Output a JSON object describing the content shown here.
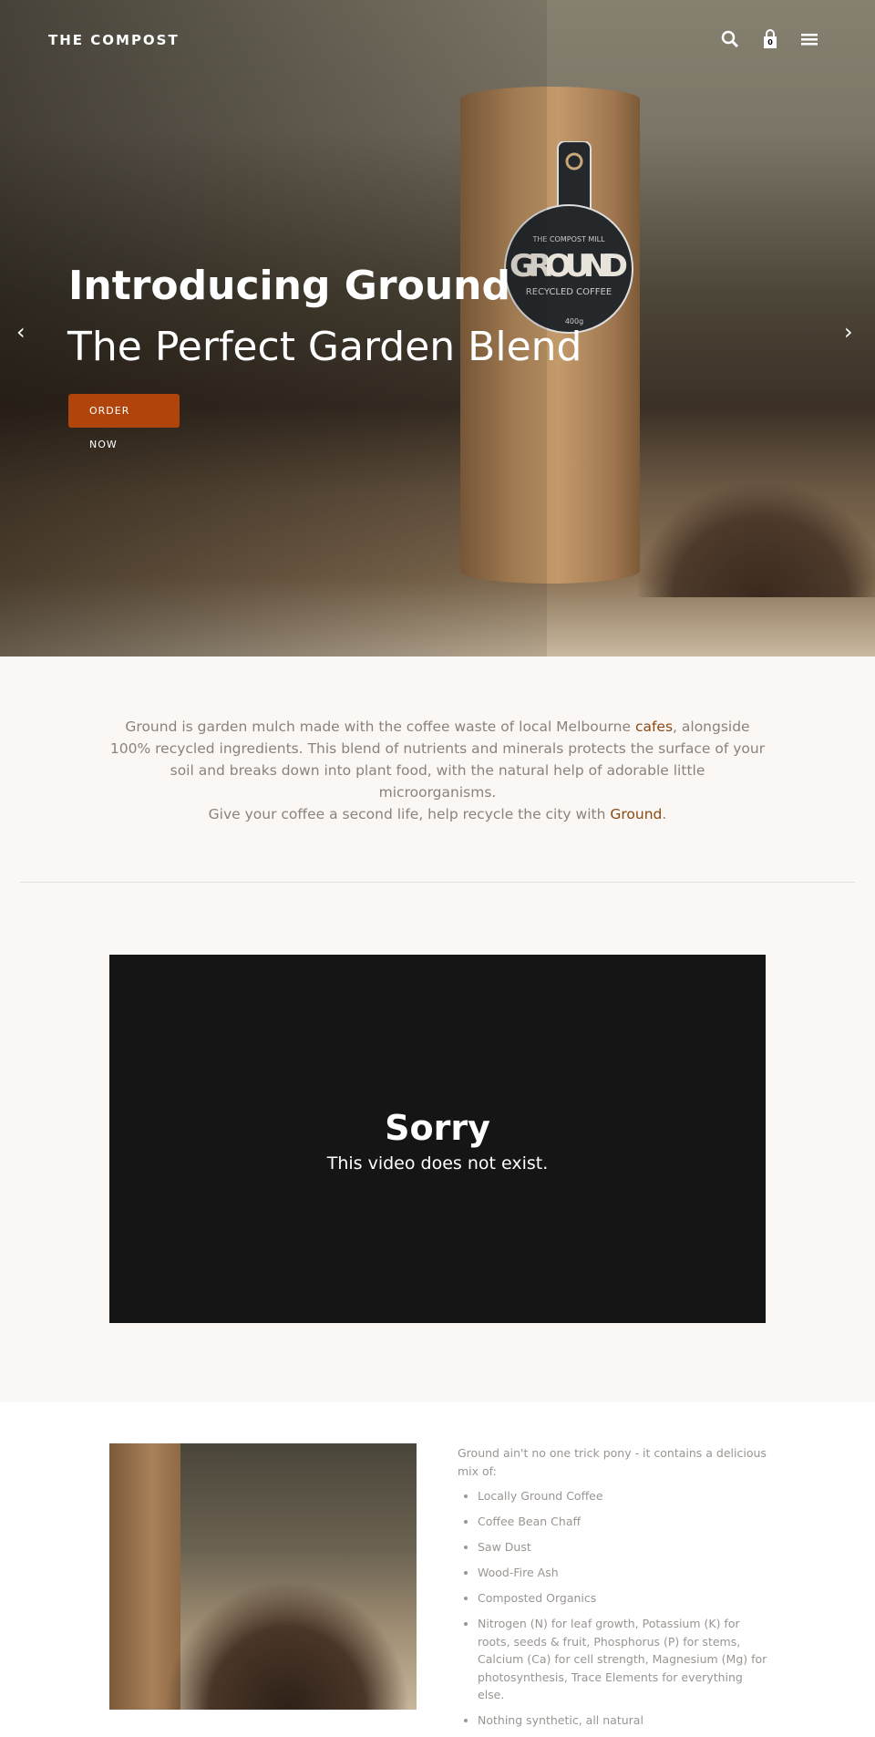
{
  "nav": {
    "logo": "THE COMPOST",
    "cart_count": "0",
    "icons": [
      "search-icon",
      "shopping-bag-icon",
      "menu-icon"
    ]
  },
  "hero": {
    "title": "Introducing Ground",
    "subtitle": "The Perfect Garden Blend",
    "button_line1": "ORDER",
    "button_line2": "NOW",
    "button_color": "#b0440a",
    "product_label": {
      "brand": "THE COMPOST MILL",
      "name": "GROUND",
      "tagline": "RECYCLED COFFEE",
      "weight": "400g"
    }
  },
  "intro": {
    "p1_a": "Ground is garden mulch made with the coffee waste of local Melbourne ",
    "p1_link": "cafes",
    "p1_b": ", alongside 100% recycled ingredients. This blend of nutrients and minerals protects the surface of your soil and breaks down into plant food, with the natural help of adorable little microorganisms.",
    "p2_a": "Give your coffee a second life, help recycle the city with ",
    "p2_link": "Ground",
    "p2_b": ".",
    "link_color": "#8a4a12"
  },
  "video": {
    "title": "Sorry",
    "message": "This video does not exist."
  },
  "details": {
    "intro": "Ground ain't no one trick pony - it contains a delicious mix of:",
    "items": [
      "Locally Ground Coffee",
      "Coffee Bean Chaff",
      "Saw Dust",
      "Wood-Fire Ash",
      "Composted Organics",
      "Nitrogen (N) for leaf growth, Potassium (K) for roots, seeds & fruit, Phosphorus (P) for stems, Calcium (Ca) for cell strength, Magnesium (Mg) for photosynthesis, Trace Elements for everything else.",
      "Nothing synthetic, all natural"
    ]
  }
}
